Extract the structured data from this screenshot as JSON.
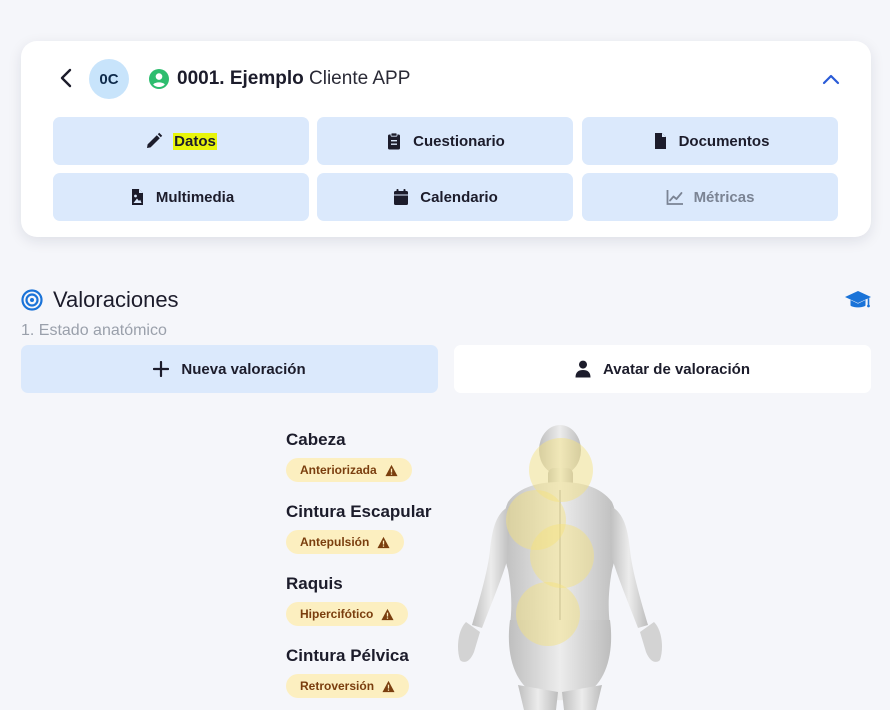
{
  "client": {
    "initials": "0C",
    "code": "0001. Ejemplo",
    "name_rest": "Cliente APP"
  },
  "tiles": [
    {
      "label": "Datos",
      "icon": "pencil-icon"
    },
    {
      "label": "Cuestionario",
      "icon": "clipboard-icon"
    },
    {
      "label": "Documentos",
      "icon": "document-icon"
    },
    {
      "label": "Multimedia",
      "icon": "image-file-icon"
    },
    {
      "label": "Calendario",
      "icon": "calendar-icon"
    },
    {
      "label": "Métricas",
      "icon": "chart-line-icon"
    }
  ],
  "section": {
    "title": "Valoraciones",
    "subtitle": "1. Estado anatómico",
    "new_button": "Nueva valoración",
    "avatar_button": "Avatar de valoración"
  },
  "regions": [
    {
      "title": "Cabeza",
      "status": "Anteriorizada"
    },
    {
      "title": "Cintura Escapular",
      "status": "Antepulsión"
    },
    {
      "title": "Raquis",
      "status": "Hipercifótico"
    },
    {
      "title": "Cintura Pélvica",
      "status": "Retroversión"
    }
  ],
  "colors": {
    "accent": "#1a73d8",
    "tile_bg": "#dbe9fc",
    "badge_bg": "#fcefc0",
    "badge_text": "#7a3e0e",
    "status_green": "#2dbd6e",
    "highlight": "#e8f50a"
  }
}
